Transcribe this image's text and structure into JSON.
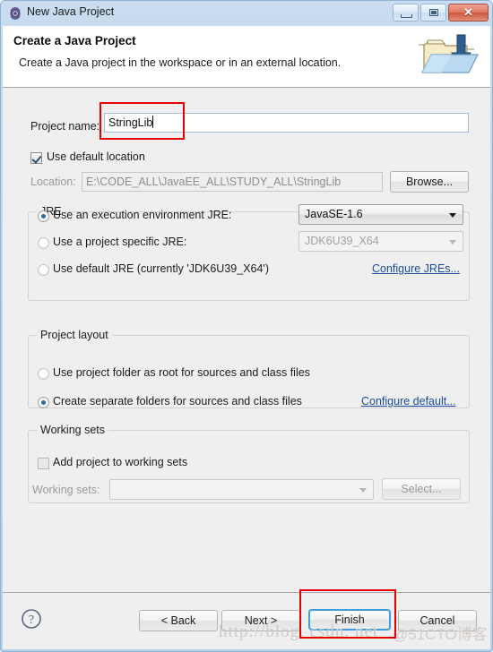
{
  "window": {
    "title": "New Java Project",
    "icon": "gear-icon",
    "buttons": {
      "minimize": "minimize-icon",
      "maximize": "maximize-icon",
      "close": "✕"
    }
  },
  "banner": {
    "title": "Create a Java Project",
    "subtitle": "Create a Java project in the workspace or in an external location.",
    "image": "java-project-folder-icon"
  },
  "form": {
    "project_name_label": "Project name:",
    "project_name_value": "StringLib",
    "use_default_location_label": "Use default location",
    "use_default_location_checked": true,
    "location_label": "Location:",
    "location_value": "E:\\CODE_ALL\\JavaEE_ALL\\STUDY_ALL\\StringLib",
    "browse_label": "Browse..."
  },
  "jre": {
    "group_title": "JRE",
    "options": [
      {
        "label": "Use an execution environment JRE:",
        "selected": true,
        "combo_value": "JavaSE-1.6",
        "combo_enabled": true
      },
      {
        "label": "Use a project specific JRE:",
        "selected": false,
        "combo_value": "JDK6U39_X64",
        "combo_enabled": false
      },
      {
        "label": "Use default JRE (currently 'JDK6U39_X64')",
        "selected": false
      }
    ],
    "configure_link": "Configure JREs..."
  },
  "project_layout": {
    "group_title": "Project layout",
    "options": [
      {
        "label": "Use project folder as root for sources and class files",
        "selected": false
      },
      {
        "label": "Create separate folders for sources and class files",
        "selected": true
      }
    ],
    "configure_link": "Configure default..."
  },
  "working_sets": {
    "group_title": "Working sets",
    "add_label": "Add project to working sets",
    "add_checked": false,
    "sets_label": "Working sets:",
    "sets_value": "",
    "select_label": "Select..."
  },
  "footer": {
    "help_icon": "question-mark-icon",
    "back_label": "< Back",
    "next_label": "Next >",
    "finish_label": "Finish",
    "cancel_label": "Cancel"
  },
  "watermark": {
    "url": "http://blog. csdn. net",
    "tag": "@51CTO博客"
  },
  "colors": {
    "accent": "#3b9ddd",
    "annotation": "#e60000",
    "link": "#1a4d99",
    "body_bg": "#efefef"
  }
}
